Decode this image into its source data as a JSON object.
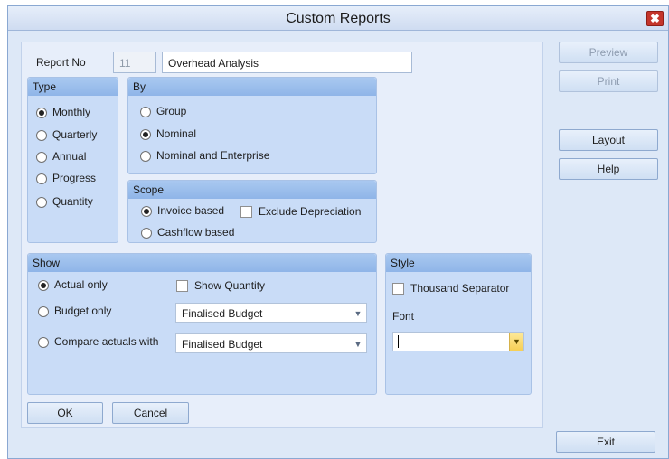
{
  "window": {
    "title": "Custom Reports",
    "close_icon": "✖"
  },
  "report": {
    "label": "Report No",
    "number": "11",
    "name": "Overhead Analysis"
  },
  "type_group": {
    "header": "Type",
    "options": [
      "Monthly",
      "Quarterly",
      "Annual",
      "Progress",
      "Quantity"
    ],
    "selected": "Monthly"
  },
  "by_group": {
    "header": "By",
    "options": [
      "Group",
      "Nominal",
      "Nominal and Enterprise"
    ],
    "selected": "Nominal"
  },
  "scope_group": {
    "header": "Scope",
    "invoice_label": "Invoice based",
    "cashflow_label": "Cashflow based",
    "exclude_label": "Exclude Depreciation",
    "selected": "Invoice based",
    "exclude_checked": false
  },
  "show_group": {
    "header": "Show",
    "actual_label": "Actual only",
    "budget_label": "Budget only",
    "compare_label": "Compare actuals with",
    "show_quantity_label": "Show Quantity",
    "show_quantity_checked": false,
    "budget_select": "Finalised Budget",
    "compare_select": "Finalised Budget",
    "selected": "Actual only"
  },
  "style_group": {
    "header": "Style",
    "thousand_label": "Thousand Separator",
    "thousand_checked": false,
    "font_label": "Font",
    "font_value": ""
  },
  "buttons": {
    "ok": "OK",
    "cancel": "Cancel",
    "preview": "Preview",
    "print": "Print",
    "layout": "Layout",
    "help": "Help",
    "exit": "Exit"
  },
  "icons": {
    "dropdown": "▼",
    "close": "close-icon"
  }
}
